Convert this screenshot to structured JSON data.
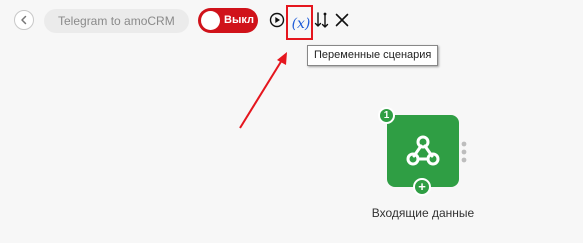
{
  "toolbar": {
    "scenario_title": "Telegram to amoCRM",
    "toggle_label": "Выкл",
    "variables_symbol": "(x)",
    "variables_tooltip": "Переменные сценария",
    "icons": [
      "chevron-left-icon",
      "play-icon",
      "variables-icon",
      "sort-icon",
      "close-icon"
    ]
  },
  "node": {
    "badge": "1",
    "label": "Входящие данные",
    "add_symbol": "+",
    "icon": "webhook-icon"
  },
  "colors": {
    "toggle_off": "#d0121a",
    "node_green": "#2f9e44",
    "variables_blue": "#1e5bd8",
    "annotation_red": "#e5161e"
  }
}
